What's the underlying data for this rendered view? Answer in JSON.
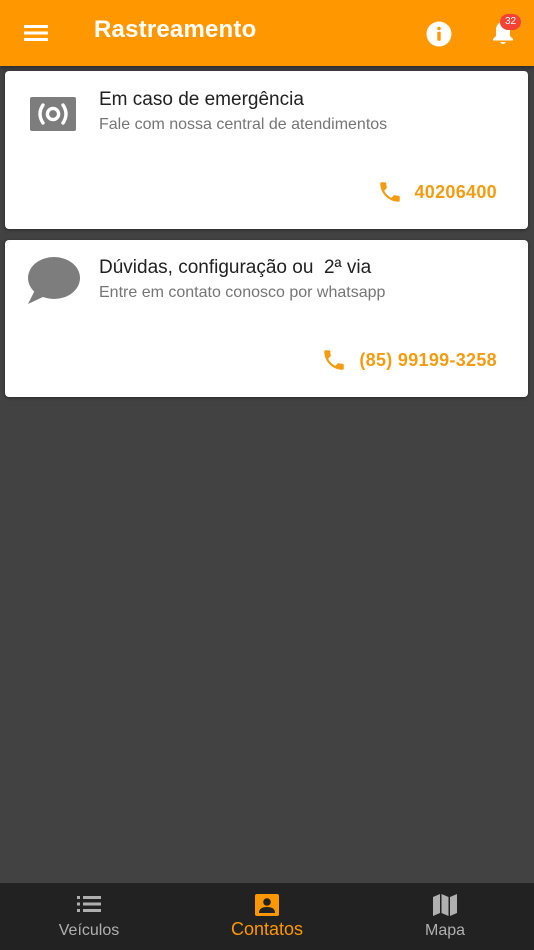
{
  "app_bar": {
    "title": "Rastreamento",
    "menu_icon": "hamburger-menu-icon",
    "info_icon": "info-icon",
    "notifications_icon": "bell-icon",
    "notification_count": "32"
  },
  "cards": [
    {
      "icon": "emergency-broadcast-icon",
      "title": "Em caso de emergência",
      "subtitle": "Fale com nossa central de atendimentos",
      "phone_icon": "phone-icon",
      "phone": "40206400"
    },
    {
      "icon": "chat-bubble-icon",
      "title": "Dúvidas, configuração ou  2ª via",
      "subtitle": "Entre em contato conosco por whatsapp",
      "phone_icon": "phone-icon",
      "phone": "(85) 99199-3258"
    }
  ],
  "bottom_nav": {
    "selected": "Contatos",
    "items": [
      {
        "label": "Veículos",
        "icon": "list-icon"
      },
      {
        "label": "Contatos",
        "icon": "contact-card-icon"
      },
      {
        "label": "Mapa",
        "icon": "map-icon"
      }
    ]
  },
  "colors": {
    "primary": "#ff9800",
    "accent_text": "#f39c12",
    "background": "#424242",
    "bottom_nav": "#222222",
    "badge": "#f44336"
  }
}
